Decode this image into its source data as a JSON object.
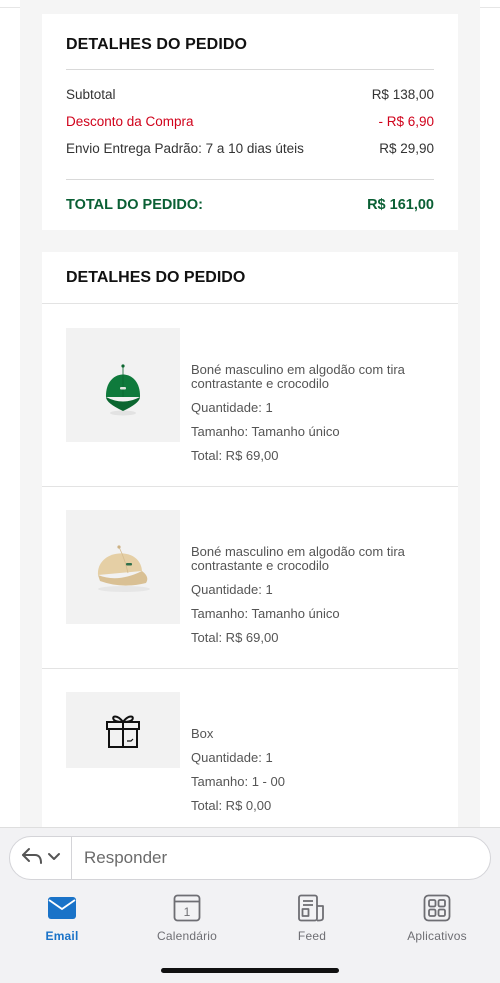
{
  "summary": {
    "title": "DETALHES DO PEDIDO",
    "subtotal_label": "Subtotal",
    "subtotal_value": "R$ 138,00",
    "discount_label": "Desconto da Compra",
    "discount_value": "- R$ 6,90",
    "shipping_label": "Envio Entrega Padrão: 7 a 10 dias úteis",
    "shipping_value": "R$ 29,90",
    "total_label": "TOTAL DO PEDIDO:",
    "total_value": "R$ 161,00"
  },
  "details": {
    "title": "DETALHES DO PEDIDO",
    "items": [
      {
        "name": "Boné masculino em algodão com tira contrastante e crocodilo",
        "quantity": "Quantidade: 1",
        "size": "Tamanho: Tamanho único",
        "total": "Total: R$ 69,00",
        "image": "green-cap"
      },
      {
        "name": "Boné masculino em algodão com tira contrastante e crocodilo",
        "quantity": "Quantidade: 1",
        "size": "Tamanho: Tamanho único",
        "total": "Total: R$ 69,00",
        "image": "beige-cap"
      },
      {
        "name": "Box",
        "quantity": "Quantidade: 1",
        "size": "Tamanho: 1 - 00",
        "total": "Total: R$ 0,00",
        "image": "gift-box-icon"
      }
    ]
  },
  "reply_bar": {
    "placeholder": "Responder",
    "icons": [
      "reply-icon",
      "chevron-down-icon"
    ]
  },
  "tab_bar": {
    "tabs": [
      {
        "label": "Email",
        "icon": "envelope-icon",
        "active": true
      },
      {
        "label": "Calendário",
        "icon": "calendar-icon",
        "day": "1",
        "active": false
      },
      {
        "label": "Feed",
        "icon": "feed-icon",
        "active": false
      },
      {
        "label": "Aplicativos",
        "icon": "apps-icon",
        "active": false
      }
    ]
  },
  "colors": {
    "discount": "#d0021b",
    "total": "#0a5f34",
    "active_tab": "#1a73c8"
  }
}
